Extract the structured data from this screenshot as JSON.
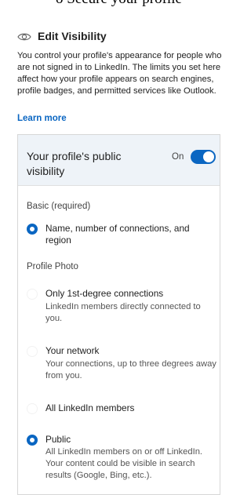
{
  "page_cutoff_text": "o Secure your profile",
  "header": {
    "icon": "eye-icon",
    "title": "Edit Visibility"
  },
  "description": "You control your profile's appearance for people who are not signed in to LinkedIn. The limits you set here affect how your profile appears on search engines, profile badges, and permitted services like Outlook.",
  "learn_more": "Learn more",
  "colors": {
    "accent": "#0a66c2",
    "panel_header_bg": "#eef3f8",
    "text": "#1f1f1f",
    "muted": "#555555"
  },
  "visibility_panel": {
    "title": "Your profile's public visibility",
    "toggle_label": "On",
    "toggle_on": true,
    "basic_section": {
      "heading": "Basic (required)",
      "option": {
        "label": "Name, number of connections, and region",
        "checked": true
      }
    },
    "photo_section": {
      "heading": "Profile Photo",
      "options": [
        {
          "label": "Only 1st-degree connections",
          "description": "LinkedIn members directly connected to you.",
          "checked": false
        },
        {
          "label": "Your network",
          "description": "Your connections, up to three degrees away from you.",
          "checked": false
        },
        {
          "label": "All LinkedIn members",
          "description": "",
          "checked": false
        },
        {
          "label": "Public",
          "description": "All LinkedIn members on or off LinkedIn. Your content could be visible in search results (Google, Bing, etc.).",
          "checked": true
        }
      ]
    }
  }
}
